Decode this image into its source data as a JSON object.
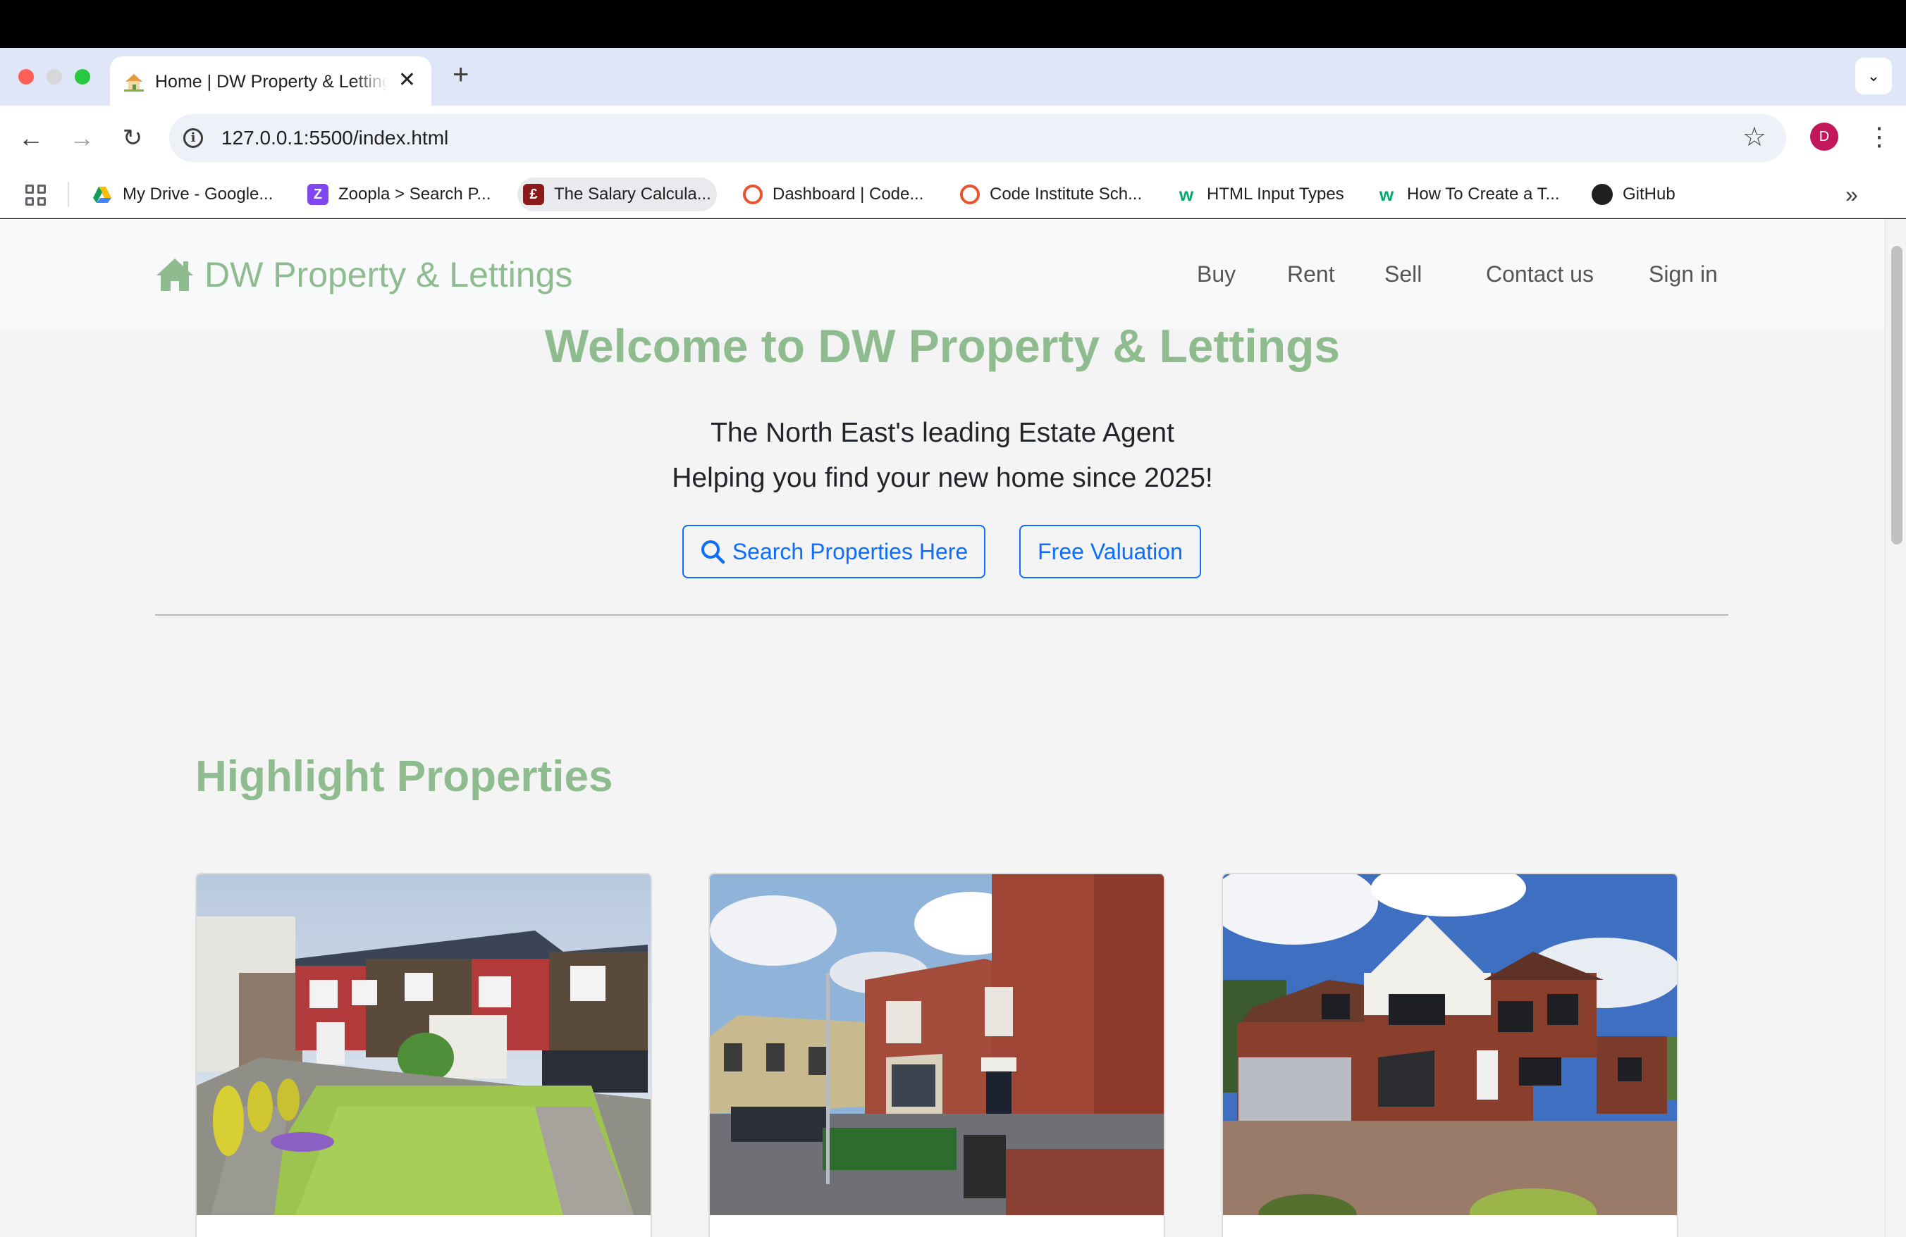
{
  "browser": {
    "tab_title": "Home | DW Property & Lettings",
    "url": "127.0.0.1:5500/index.html",
    "profile_initial": "D",
    "bookmarks": [
      {
        "label": "My Drive - Google...",
        "icon": "google-drive-icon"
      },
      {
        "label": "Zoopla > Search P...",
        "icon": "zoopla-icon"
      },
      {
        "label": "The Salary Calcula...",
        "icon": "pound-icon"
      },
      {
        "label": "Dashboard | Code...",
        "icon": "code-institute-icon"
      },
      {
        "label": "Code Institute Sch...",
        "icon": "code-institute-icon"
      },
      {
        "label": "HTML Input Types",
        "icon": "w3schools-icon"
      },
      {
        "label": "How To Create a T...",
        "icon": "w3schools-icon"
      },
      {
        "label": "GitHub",
        "icon": "github-icon"
      }
    ]
  },
  "site": {
    "brand": "DW Property & Lettings",
    "brand_color": "#8fbc8f",
    "nav": [
      "Buy",
      "Rent",
      "Sell",
      "Contact us",
      "Sign in"
    ],
    "hero": {
      "title": "Welcome to DW Property & Lettings",
      "line1": "The North East's leading Estate Agent",
      "line2": "Helping you find your new home since 2025!",
      "search_button": "Search Properties Here",
      "valuation_button": "Free Valuation"
    },
    "highlights": {
      "title": "Highlight Properties",
      "cards": [
        {
          "image": "semi-detached-house-with-garden-photo"
        },
        {
          "image": "red-brick-terraced-house-photo"
        },
        {
          "image": "detached-house-with-garage-photo"
        }
      ]
    },
    "accent_color": "#0d6efd"
  }
}
